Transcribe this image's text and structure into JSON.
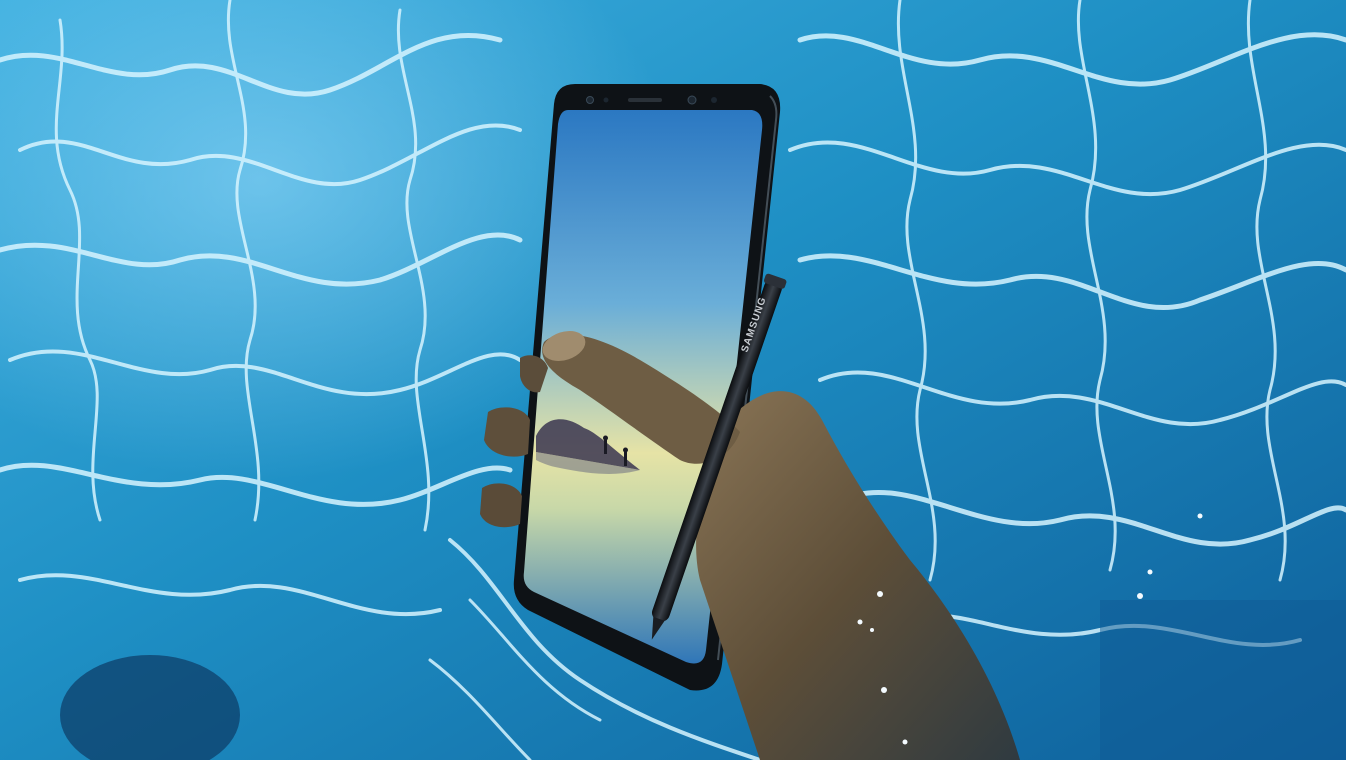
{
  "scene": {
    "subject": "smartphone-with-stylus-held-in-water",
    "colors": {
      "water_deep": "#0e5f9a",
      "water_mid": "#1e8fc4",
      "water_light": "#49b7e6",
      "caustic": "#c9f1ff",
      "phone_body": "#0e1216",
      "screen_sky_top": "#2f7cc4",
      "screen_sky_bottom": "#e8e3a0",
      "skin": "#6a5a42"
    }
  },
  "stylus": {
    "brand_label": "SAMSUNG"
  }
}
